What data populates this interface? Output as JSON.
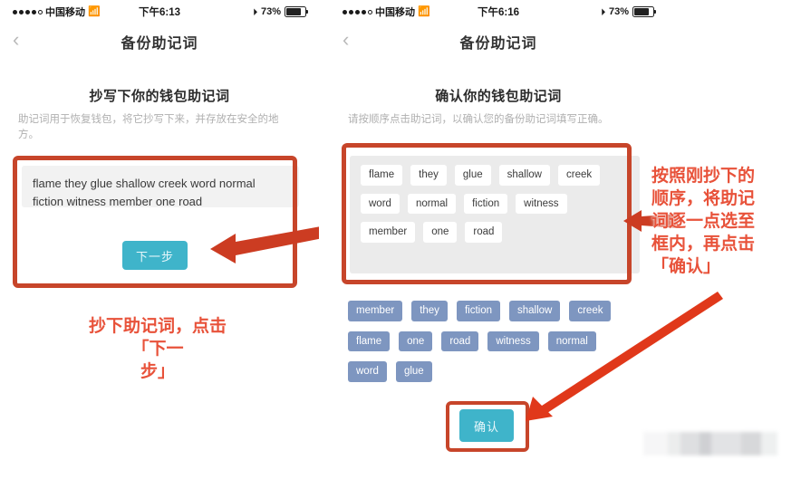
{
  "left_phone": {
    "status_bar": {
      "carrier": "中国移动",
      "wifi_icon": "wifi-icon",
      "time": "下午6:13",
      "battery_percent": "73%",
      "lock_icon": "rotation-lock-icon"
    },
    "nav": {
      "back_icon": "chevron-left-icon",
      "title": "备份助记词"
    },
    "heading": "抄写下你的钱包助记词",
    "subheading": "助记词用于恢复钱包，将它抄写下来，并存放在安全的地方。",
    "mnemonic_text": "flame they glue shallow creek word normal fiction witness member one road",
    "next_button": "下一步",
    "annotation": "抄下助记词，点击「下一\n步」"
  },
  "right_phone": {
    "status_bar": {
      "carrier": "中国移动",
      "wifi_icon": "wifi-icon",
      "time": "下午6:16",
      "battery_percent": "73%",
      "lock_icon": "rotation-lock-icon"
    },
    "nav": {
      "back_icon": "chevron-left-icon",
      "title": "备份助记词"
    },
    "heading": "确认你的钱包助记词",
    "subheading": "请按顺序点击助记词，以确认您的备份助记词填写正确。",
    "selected_words": [
      [
        "flame",
        "they",
        "glue",
        "shallow",
        "creek"
      ],
      [
        "word",
        "normal",
        "fiction",
        "witness"
      ],
      [
        "member",
        "one",
        "road"
      ]
    ],
    "pool_words": [
      [
        "member",
        "they",
        "fiction",
        "shallow",
        "creek"
      ],
      [
        "flame",
        "one",
        "road",
        "witness",
        "normal"
      ],
      [
        "word",
        "glue"
      ]
    ],
    "confirm_button": "确认",
    "annotation": "按照刚抄下的\n顺序，将助记\n词逐一点选至\n框内，再点击\n「确认」"
  },
  "colors": {
    "teal_button": "#3fb4ca",
    "annotation_red": "#e8523a",
    "box_red": "#c7452a",
    "chip_blue": "#7e96c0",
    "panel_grey": "#ebebeb",
    "textarea_grey": "#f2f2f2"
  }
}
